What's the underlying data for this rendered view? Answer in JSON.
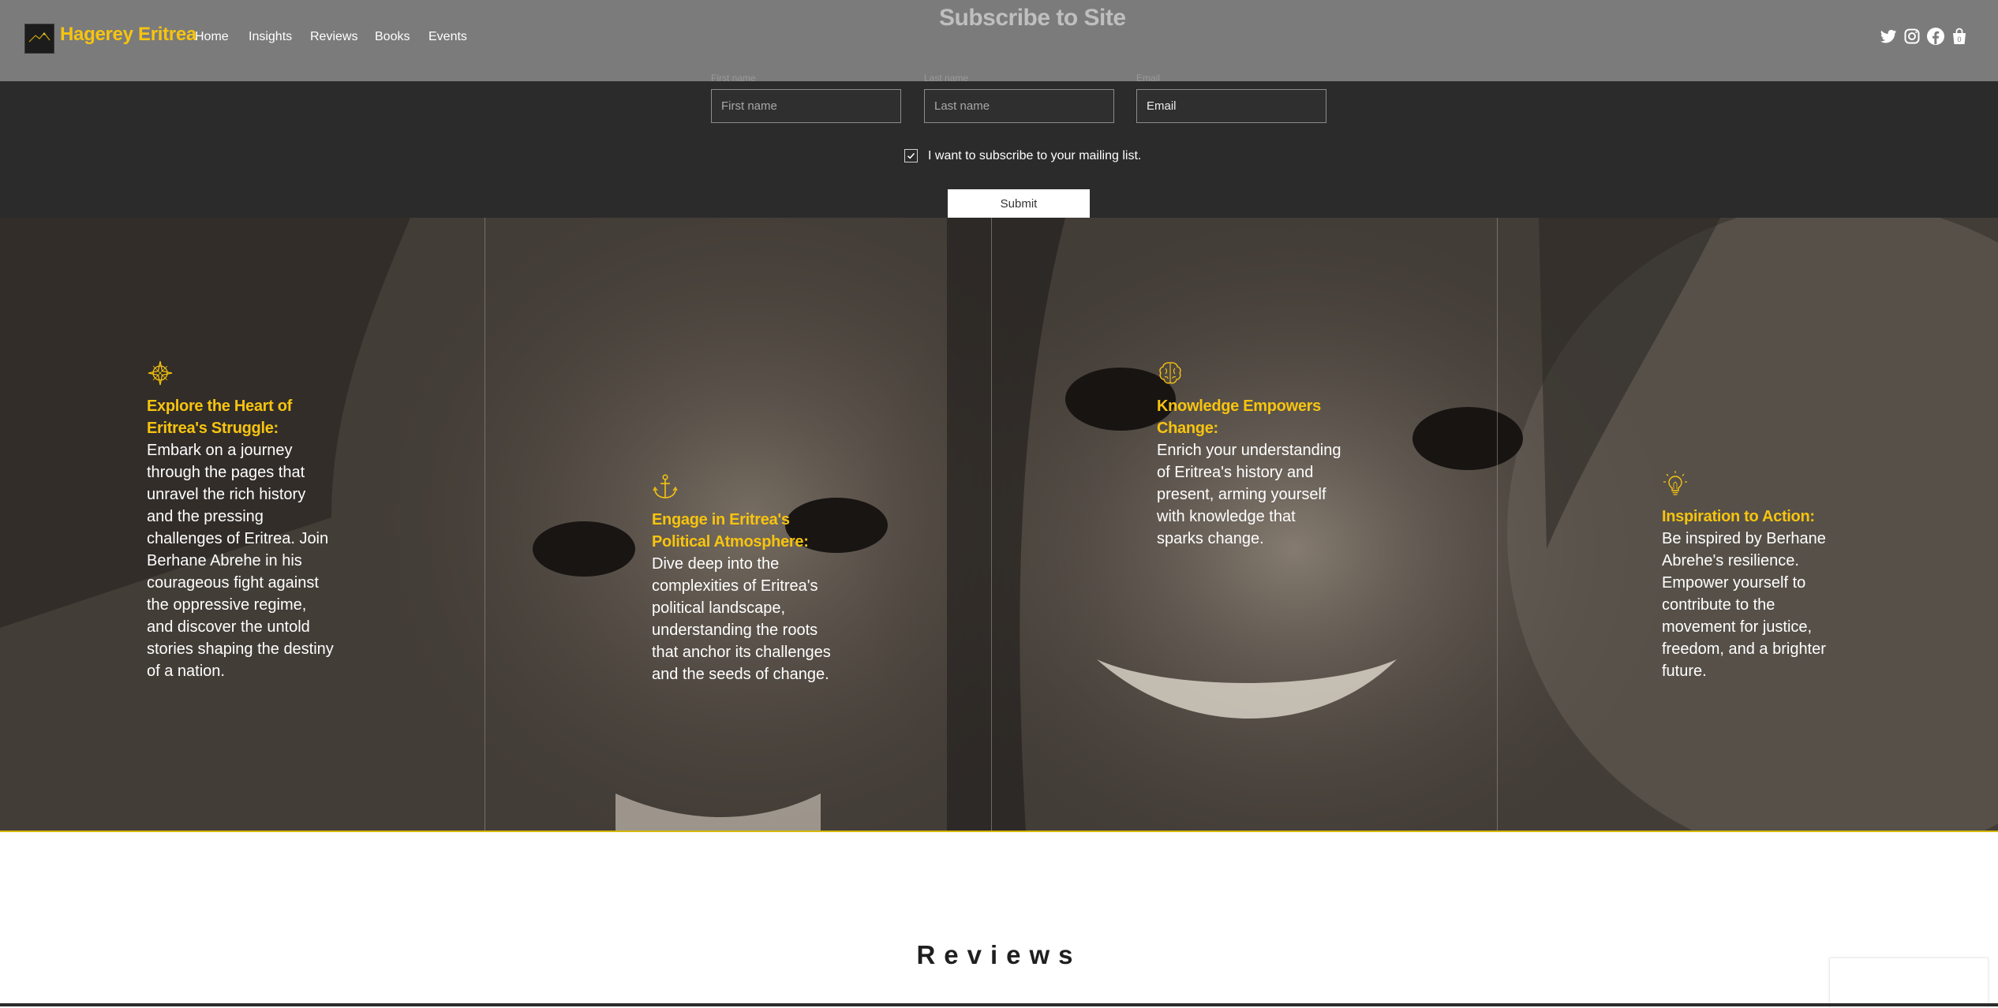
{
  "header": {
    "brand": "Hagerey Eritrea",
    "nav": [
      "Home",
      "Insights",
      "Reviews",
      "Books",
      "Events"
    ],
    "subscribe_title": "Subscribe to Site",
    "social_icons": [
      "twitter-icon",
      "instagram-icon",
      "facebook-icon",
      "cart-icon"
    ],
    "cart_count": "0"
  },
  "form": {
    "first_name_label": "First name",
    "first_name_placeholder": "First name",
    "last_name_label": "Last name",
    "last_name_placeholder": "Last name",
    "email_label": "Email",
    "email_placeholder": "Email",
    "checkbox_label": "I want to subscribe to your mailing list.",
    "checkbox_checked": true,
    "submit_label": "Submit"
  },
  "features": [
    {
      "icon": "compass-icon",
      "title": "Explore the Heart of Eritrea's Struggle:",
      "body": "Embark on a journey through the pages that unravel the rich history and the pressing challenges of Eritrea. Join Berhane Abrehe in his courageous fight against the oppressive regime, and discover the untold stories shaping the destiny of a nation."
    },
    {
      "icon": "anchor-icon",
      "title": "Engage in Eritrea's Political Atmosphere:",
      "body": "Dive deep into the complexities of Eritrea's political landscape, understanding the roots that anchor its challenges and the seeds of change."
    },
    {
      "icon": "brain-icon",
      "title": "Knowledge Empowers Change:",
      "body": "Enrich your understanding of Eritrea's history and present, arming yourself with knowledge that sparks change."
    },
    {
      "icon": "lightbulb-icon",
      "title": "Inspiration to Action:",
      "body": "Be inspired by Berhane Abrehe's resilience. Empower yourself to contribute to the movement for justice, freedom, and a brighter future."
    }
  ],
  "reviews_heading": "Reviews",
  "colors": {
    "accent": "#f7c40f",
    "header_bg": "#7b7b7b",
    "form_bg": "#2b2b2b"
  }
}
